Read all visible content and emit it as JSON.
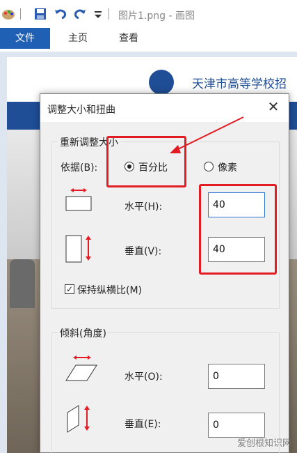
{
  "window": {
    "title": "图片1.png - 画图"
  },
  "ribbon": {
    "tabs": [
      {
        "label": "文件"
      },
      {
        "label": "主页"
      },
      {
        "label": "查看"
      }
    ]
  },
  "background_image": {
    "header_text": "天津市高等学校招"
  },
  "dialog": {
    "title": "调整大小和扭曲",
    "close_icon": "close-icon",
    "resize": {
      "group_label": "重新调整大小",
      "basis_label": "依据(B):",
      "options": [
        {
          "label": "百分比",
          "selected": true
        },
        {
          "label": "像素",
          "selected": false
        }
      ],
      "horizontal_label": "水平(H):",
      "horizontal_value": "40",
      "vertical_label": "垂直(V):",
      "vertical_value": "40",
      "keep_aspect_label": "保持纵横比(M)",
      "keep_aspect_checked": true
    },
    "skew": {
      "group_label": "倾斜(角度)",
      "horizontal_label": "水平(O):",
      "horizontal_value": "0",
      "vertical_label": "垂直(E):",
      "vertical_value": "0"
    }
  },
  "colors": {
    "accent": "#1f5fb4",
    "annotation_red": "#e31b23"
  },
  "watermark": "爱创根知识网"
}
